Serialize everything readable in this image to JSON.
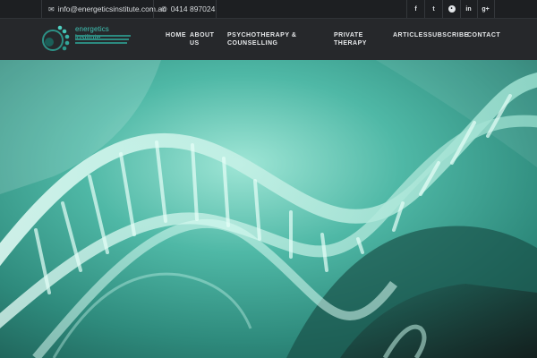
{
  "topbar": {
    "email": "info@energeticsinstitute.com.au",
    "email_icon": "envelope-icon",
    "phone": "0414 897024",
    "phone_icon": "phone-icon",
    "social": [
      {
        "name": "facebook-icon",
        "glyph": "f"
      },
      {
        "name": "twitter-icon",
        "glyph": "t"
      },
      {
        "name": "reddit-icon",
        "glyph": "•"
      },
      {
        "name": "linkedin-icon",
        "glyph": "in"
      },
      {
        "name": "google-plus-icon",
        "glyph": "g+"
      }
    ]
  },
  "logo": {
    "brand": "energetics institute"
  },
  "nav": {
    "home": "HOME",
    "about_1": "ABOUT",
    "about_2": "US",
    "psycho_1": "PSYCHOTHERAPY &",
    "psycho_2": "COUNSELLING",
    "private_1": "PRIVATE",
    "private_2": "THERAPY",
    "articles": "ARTICLES",
    "subscribe": "SUBSCRIBE",
    "contact": "CONTACT"
  },
  "colors": {
    "brand_teal": "#3fc2b4",
    "header_dark": "#26282b",
    "hero_teal": "#3aa393"
  }
}
